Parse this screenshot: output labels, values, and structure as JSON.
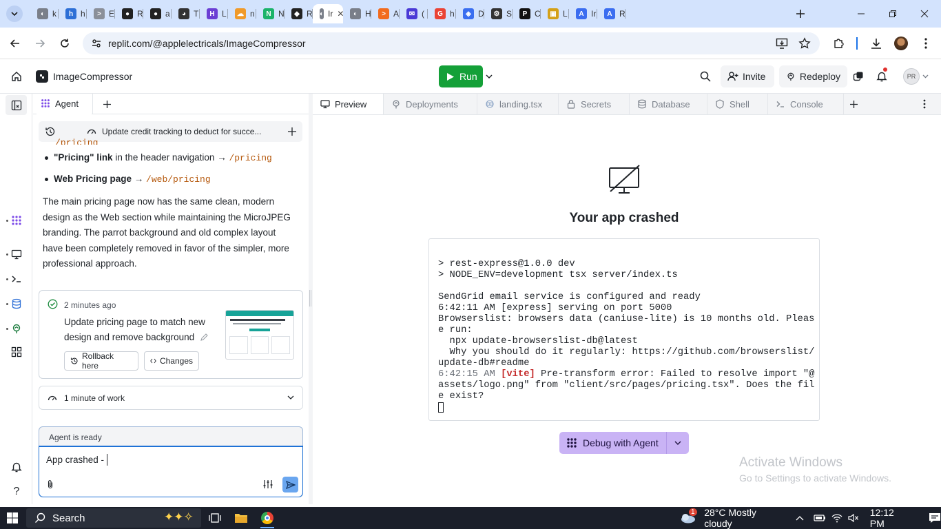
{
  "browser": {
    "tabs": [
      {
        "letter": "k",
        "color": "#7a7f89",
        "glyph": "◐"
      },
      {
        "letter": "h",
        "color": "#2d6fd6",
        "glyph": "h"
      },
      {
        "letter": "E",
        "color": "#8a8f99",
        "glyph": ">"
      },
      {
        "letter": "R",
        "color": "#222",
        "glyph": "●"
      },
      {
        "letter": "a",
        "color": "#222",
        "glyph": "●"
      },
      {
        "letter": "T",
        "color": "#333",
        "glyph": "◕"
      },
      {
        "letter": "L",
        "color": "#6b3fd4",
        "glyph": "H"
      },
      {
        "letter": "n",
        "color": "#f09a2a",
        "glyph": "☁"
      },
      {
        "letter": "N",
        "color": "#1bb36a",
        "glyph": "N"
      },
      {
        "letter": "R",
        "color": "#222",
        "glyph": "◆"
      },
      {
        "letter": "Ir",
        "color": "#7a7f89",
        "glyph": "◐",
        "active": true
      },
      {
        "letter": "H",
        "color": "#7a7f89",
        "glyph": "◐"
      },
      {
        "letter": "A",
        "color": "#f26b1d",
        "glyph": ">"
      },
      {
        "letter": "(",
        "color": "#4a3ad6",
        "glyph": "✉"
      },
      {
        "letter": "h",
        "color": "#ea4335",
        "glyph": "G"
      },
      {
        "letter": "D",
        "color": "#3a6ef0",
        "glyph": "◈"
      },
      {
        "letter": "S",
        "color": "#333",
        "glyph": "⚙"
      },
      {
        "letter": "C",
        "color": "#111",
        "glyph": "P"
      },
      {
        "letter": "L",
        "color": "#d4a017",
        "glyph": "▣"
      },
      {
        "letter": "Ir",
        "color": "#3b6df0",
        "glyph": "A"
      },
      {
        "letter": "R",
        "color": "#3b6df0",
        "glyph": "A"
      }
    ],
    "url": "replit.com/@applelectricals/ImageCompressor"
  },
  "header": {
    "app_name": "ImageCompressor",
    "run_label": "Run",
    "invite_label": "Invite",
    "redeploy_label": "Redeploy",
    "avatar_initials": "PR"
  },
  "agent": {
    "tab_label": "Agent",
    "context_title": "Update credit tracking to deduct for succe...",
    "partial_code": "/pricing",
    "bullets": [
      {
        "bold": "\"Pricing\" link",
        "text": " in the header navigation → ",
        "code": "/pricing"
      },
      {
        "bold": "Web Pricing page",
        "text": " → ",
        "code": "/web/pricing"
      }
    ],
    "paragraph": "The main pricing page now has the same clean, modern design as the Web section while maintaining the MicroJPEG branding. The parrot background and old complex layout have been completely removed in favor of the simpler, more professional approach.",
    "checkpoint": {
      "time": "2 minutes ago",
      "title": "Update pricing page to match new design and remove background",
      "rollback_label": "Rollback here",
      "changes_label": "Changes"
    },
    "work_label": "1 minute of work",
    "status": "Agent is ready",
    "input_value": "App crashed - "
  },
  "right_tabs": [
    {
      "label": "Preview",
      "icon": "monitor-icon",
      "active": true
    },
    {
      "label": "Deployments",
      "icon": "deployments-icon"
    },
    {
      "label": "landing.tsx",
      "icon": "file-icon"
    },
    {
      "label": "Secrets",
      "icon": "lock-icon"
    },
    {
      "label": "Database",
      "icon": "database-icon"
    },
    {
      "label": "Shell",
      "icon": "shell-icon"
    },
    {
      "label": "Console",
      "icon": "console-icon"
    }
  ],
  "preview": {
    "crash_title": "Your app crashed",
    "terminal": {
      "line1": "> rest-express@1.0.0 dev",
      "line2": "> NODE_ENV=development tsx server/index.ts",
      "line3": "SendGrid email service is configured and ready",
      "line4": "6:42:11 AM [express] serving on port 5000",
      "line5": "Browserslist: browsers data (caniuse-lite) is 10 months old. Pleas",
      "line6": "e run:",
      "line7": "  npx update-browserslist-db@latest",
      "line8": "  Why you should do it regularly: https://github.com/browserslist/",
      "line9": "update-db#readme",
      "line10_time": "6:42:15 AM",
      "line10_tag": "[vite]",
      "line10_text": " Pre-transform error: Failed to resolve import \"@",
      "line11": "assets/logo.png\" from \"client/src/pages/pricing.tsx\". Does the fil",
      "line12": "e exist?"
    },
    "debug_label": "Debug with Agent",
    "watermark_title": "Activate Windows",
    "watermark_sub": "Go to Settings to activate Windows."
  },
  "taskbar": {
    "search_label": "Search",
    "weather": "28°C  Mostly cloudy",
    "weather_badge": "1",
    "time": "12:12 PM"
  }
}
